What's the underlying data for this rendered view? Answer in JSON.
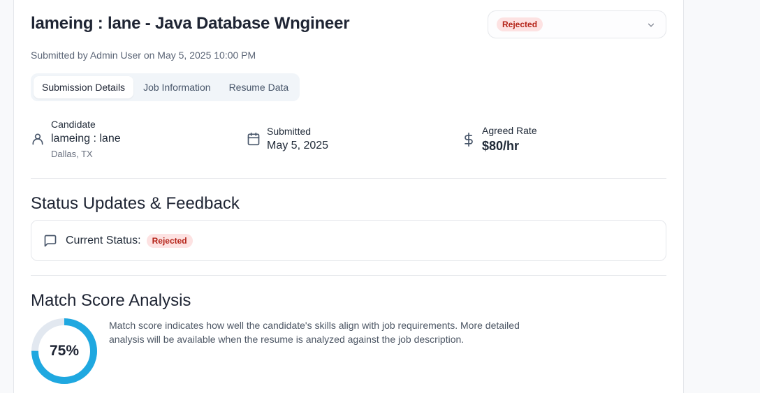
{
  "header": {
    "title": "lameing : lane - Java Database Wngineer",
    "submitted_by": "Submitted by Admin User on May 5, 2025 10:00 PM"
  },
  "status_select": {
    "value": "Rejected",
    "icon": "chevron-down-icon"
  },
  "tabs": [
    {
      "label": "Submission Details",
      "active": true
    },
    {
      "label": "Job Information",
      "active": false
    },
    {
      "label": "Resume Data",
      "active": false
    }
  ],
  "details": {
    "candidate": {
      "label": "Candidate",
      "name": "lameing : lane",
      "location": "Dallas, TX",
      "icon": "user-icon"
    },
    "submitted": {
      "label": "Submitted",
      "date": "May 5, 2025",
      "icon": "calendar-icon"
    },
    "rate": {
      "label": "Agreed Rate",
      "value": "$80/hr",
      "icon": "dollar-icon"
    }
  },
  "status_section": {
    "title": "Status Updates & Feedback",
    "current_label": "Current Status:",
    "current_value": "Rejected",
    "icon": "message-square-icon"
  },
  "match_section": {
    "title": "Match Score Analysis",
    "score_text": "75%",
    "score_fraction": 0.75,
    "description": "Match score indicates how well the candidate's skills align with job requirements. More detailed analysis will be available when the resume is analyzed against the job description."
  },
  "colors": {
    "badge_bg": "#fde2e2",
    "badge_text": "#b42318",
    "score_ring": "#1fa8e0",
    "score_track": "#e2e8f0"
  }
}
